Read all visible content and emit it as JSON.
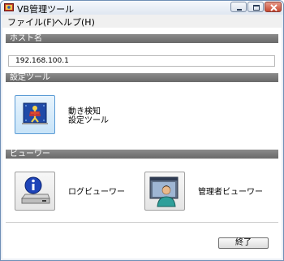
{
  "window": {
    "title": "VB管理ツール"
  },
  "menu": {
    "file": "ファイル(F)",
    "help": "ヘルプ(H)"
  },
  "host": {
    "section_label": "ホスト名",
    "value": "192.168.100.1"
  },
  "settings": {
    "section_label": "設定ツール",
    "motion_tool": {
      "label_line1": "動き検知",
      "label_line2": "設定ツール",
      "icon": "motion-detection-icon"
    }
  },
  "viewer": {
    "section_label": "ビューワー",
    "log_viewer": {
      "label": "ログビューワー",
      "icon": "info-server-icon"
    },
    "admin_viewer": {
      "label": "管理者ビューワー",
      "icon": "admin-person-icon"
    }
  },
  "footer": {
    "exit_label": "終了"
  },
  "colors": {
    "section_bar": "#7a7a7a",
    "selected_border": "#5b9bd5",
    "window_frame": "#6f8fb6"
  }
}
